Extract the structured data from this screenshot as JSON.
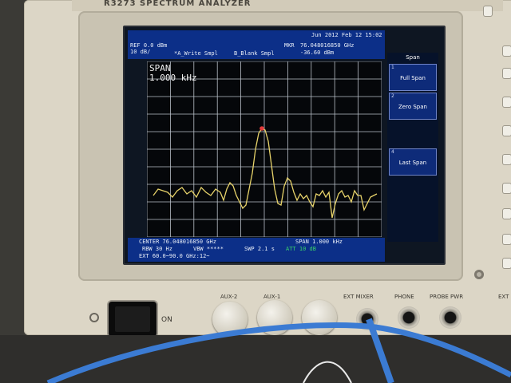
{
  "brand": {
    "title": "R3273 SPECTRUM ANALYZER"
  },
  "header": {
    "datetime": "Jun 2012 Feb 12 15:02",
    "ref_label": "REF 0.0 dBm",
    "scale_label": "10 dB/",
    "trace_a": "*A_Write Smpl",
    "trace_b": "B_Blank Smpl",
    "mkr_label": "MKR",
    "mkr_freq": "76.048016850 GHz",
    "mkr_level": "-36.60 dBm"
  },
  "plot": {
    "span_title": "SPAN",
    "span_value": "1.000 kHz",
    "grid_divisions": {
      "x": 10,
      "y": 10
    },
    "trace_color": "#e7d36a",
    "marker_color": "#e43a3a",
    "grid_color": "#b9c0c9"
  },
  "softkeys": {
    "title": "Span",
    "items": [
      {
        "num": "1",
        "label": "Full Span"
      },
      {
        "num": "2",
        "label": "Zero Span"
      },
      {
        "num": "4",
        "label": "Last Span"
      }
    ]
  },
  "footer": {
    "center": "CENTER 76.048016850 GHz",
    "span": "SPAN 1.000 kHz",
    "rbw": "RBW 30 Hz",
    "vbw": "VBW *****",
    "swp": "SWP 2.1 s",
    "att": "ATT 10 dB",
    "ext": "EXT 60.0~90.0 GHz:12~"
  },
  "panel": {
    "power_label": "ON",
    "aux2": "AUX-2",
    "aux1": "AUX-1",
    "ext_mixer": "EXT MIXER",
    "phone": "PHONE",
    "probe_pwr": "PROBE PWR",
    "ext": "EXT"
  }
}
